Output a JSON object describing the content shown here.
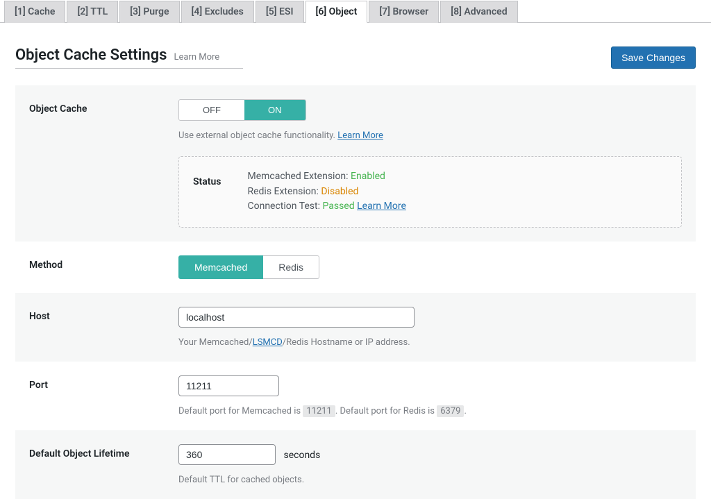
{
  "tabs": [
    {
      "label": "[1] Cache"
    },
    {
      "label": "[2] TTL"
    },
    {
      "label": "[3] Purge"
    },
    {
      "label": "[4] Excludes"
    },
    {
      "label": "[5] ESI"
    },
    {
      "label": "[6] Object"
    },
    {
      "label": "[7] Browser"
    },
    {
      "label": "[8] Advanced"
    }
  ],
  "page": {
    "title": "Object Cache Settings",
    "learn_more": "Learn More",
    "save_button": "Save Changes"
  },
  "object_cache": {
    "label": "Object Cache",
    "off": "OFF",
    "on": "ON",
    "desc_prefix": "Use external object cache functionality. ",
    "desc_link": "Learn More"
  },
  "status": {
    "label": "Status",
    "memcached_label": "Memcached Extension: ",
    "memcached_value": "Enabled",
    "redis_label": "Redis Extension: ",
    "redis_value": "Disabled",
    "conn_label": "Connection Test: ",
    "conn_value": "Passed",
    "conn_link": "Learn More"
  },
  "method": {
    "label": "Method",
    "memcached": "Memcached",
    "redis": "Redis"
  },
  "host": {
    "label": "Host",
    "value": "localhost",
    "desc_prefix": "Your Memcached/",
    "desc_link": "LSMCD",
    "desc_suffix": "/Redis Hostname or IP address."
  },
  "port": {
    "label": "Port",
    "value": "11211",
    "desc_1": "Default port for Memcached is ",
    "chip_1": "11211",
    "desc_2": ". Default port for Redis is ",
    "chip_2": "6379",
    "desc_3": "."
  },
  "lifetime": {
    "label": "Default Object Lifetime",
    "value": "360",
    "unit": "seconds",
    "desc": "Default TTL for cached objects."
  }
}
